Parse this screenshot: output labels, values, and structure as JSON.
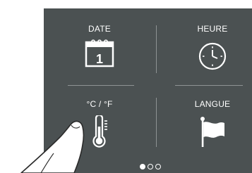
{
  "menu": {
    "tiles": [
      {
        "label": "DATE",
        "icon": "calendar-icon",
        "value": "1"
      },
      {
        "label": "HEURE",
        "icon": "clock-icon"
      },
      {
        "label": "°C / °F",
        "icon": "thermometer-icon"
      },
      {
        "label": "LANGUE",
        "icon": "flag-icon"
      }
    ]
  },
  "pagination": {
    "pages": 3,
    "current": 1
  },
  "colors": {
    "panel": "#4b5152",
    "divider": "#8e9394",
    "foreground": "#ffffff"
  }
}
